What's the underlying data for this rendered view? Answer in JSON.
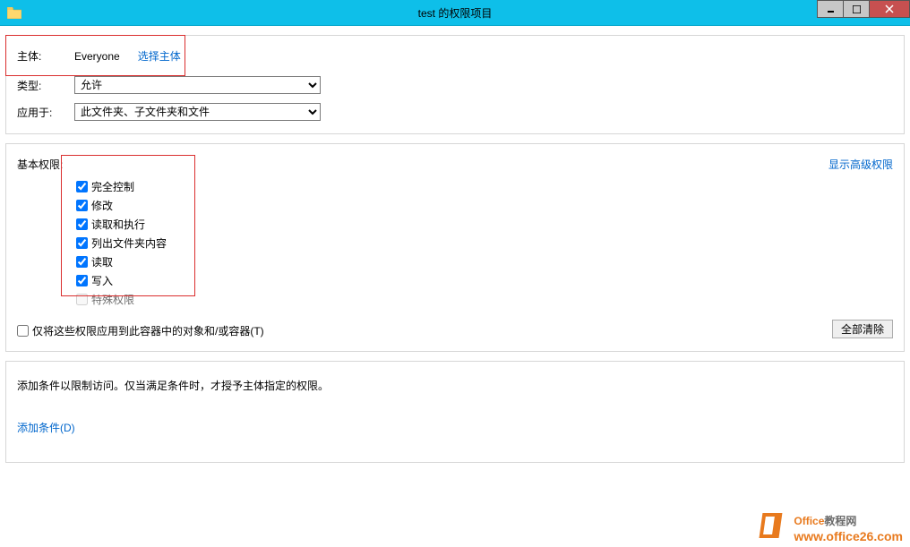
{
  "window": {
    "title": "test 的权限项目"
  },
  "principal": {
    "label": "主体:",
    "value": "Everyone",
    "select_link": "选择主体"
  },
  "type": {
    "label": "类型:",
    "selected": "允许"
  },
  "applies_to": {
    "label": "应用于:",
    "selected": "此文件夹、子文件夹和文件"
  },
  "permissions": {
    "heading": "基本权限:",
    "show_advanced": "显示高级权限",
    "items": [
      {
        "label": "完全控制",
        "checked": true,
        "enabled": true
      },
      {
        "label": "修改",
        "checked": true,
        "enabled": true
      },
      {
        "label": "读取和执行",
        "checked": true,
        "enabled": true
      },
      {
        "label": "列出文件夹内容",
        "checked": true,
        "enabled": true
      },
      {
        "label": "读取",
        "checked": true,
        "enabled": true
      },
      {
        "label": "写入",
        "checked": true,
        "enabled": true
      },
      {
        "label": "特殊权限",
        "checked": false,
        "enabled": false
      }
    ],
    "apply_only": "仅将这些权限应用到此容器中的对象和/或容器(T)",
    "clear_all": "全部清除"
  },
  "conditions": {
    "description": "添加条件以限制访问。仅当满足条件时，才授予主体指定的权限。",
    "add_link": "添加条件(D)"
  },
  "watermark": {
    "title_1": "Office",
    "title_2": "教程网",
    "url": "www.office26.com"
  }
}
